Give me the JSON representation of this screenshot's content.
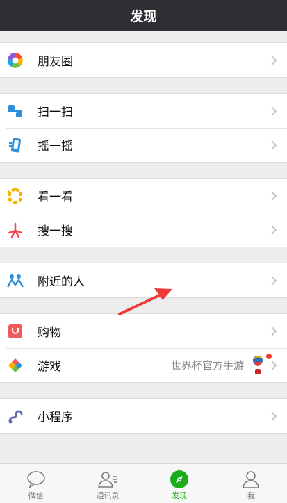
{
  "header": {
    "title": "发现"
  },
  "groups": [
    [
      {
        "label": "朋友圈",
        "icon": "moments-icon"
      }
    ],
    [
      {
        "label": "扫一扫",
        "icon": "scan-icon"
      },
      {
        "label": "摇一摇",
        "icon": "shake-icon"
      }
    ],
    [
      {
        "label": "看一看",
        "icon": "top-stories-icon"
      },
      {
        "label": "搜一搜",
        "icon": "search-icon"
      }
    ],
    [
      {
        "label": "附近的人",
        "icon": "people-nearby-icon"
      }
    ],
    [
      {
        "label": "购物",
        "icon": "shopping-icon"
      },
      {
        "label": "游戏",
        "icon": "games-icon",
        "extra": "世界杯官方手游"
      }
    ],
    [
      {
        "label": "小程序",
        "icon": "mini-programs-icon"
      }
    ]
  ],
  "tabs": [
    {
      "label": "微信",
      "icon": "chat-icon"
    },
    {
      "label": "通讯录",
      "icon": "contacts-icon"
    },
    {
      "label": "发现",
      "icon": "discover-icon",
      "active": true
    },
    {
      "label": "我",
      "icon": "me-icon"
    }
  ],
  "colors": {
    "header_bg": "#2e2e33",
    "active_green": "#1aad19",
    "badge_red": "#f43530"
  }
}
